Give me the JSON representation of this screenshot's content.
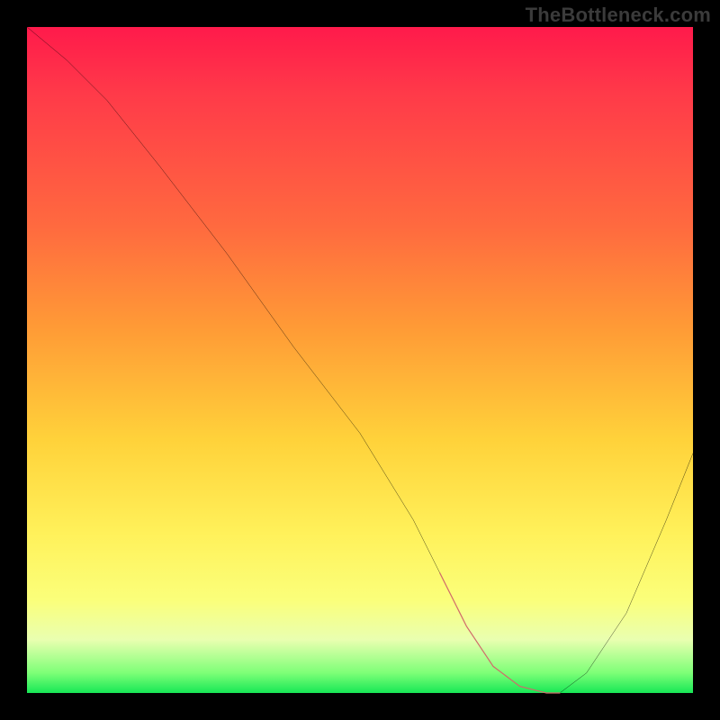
{
  "watermark": "TheBottleneck.com",
  "chart_data": {
    "type": "line",
    "title": "",
    "xlabel": "",
    "ylabel": "",
    "xlim": [
      0,
      100
    ],
    "ylim": [
      0,
      100
    ],
    "series": [
      {
        "name": "bottleneck-curve",
        "x": [
          0,
          6,
          12,
          20,
          30,
          40,
          50,
          58,
          62,
          66,
          70,
          74,
          78,
          80,
          84,
          90,
          96,
          100
        ],
        "y": [
          100,
          95,
          89,
          79,
          66,
          52,
          39,
          26,
          18,
          10,
          4,
          1,
          0,
          0,
          3,
          12,
          26,
          36
        ]
      }
    ],
    "valley_marker": {
      "x_start": 62,
      "x_end": 80,
      "color": "#d06a6a"
    },
    "background_gradient": {
      "top": "#ff1a4b",
      "mid_high": "#ff9a36",
      "mid_low": "#fff15a",
      "bottom": "#17e756"
    }
  }
}
